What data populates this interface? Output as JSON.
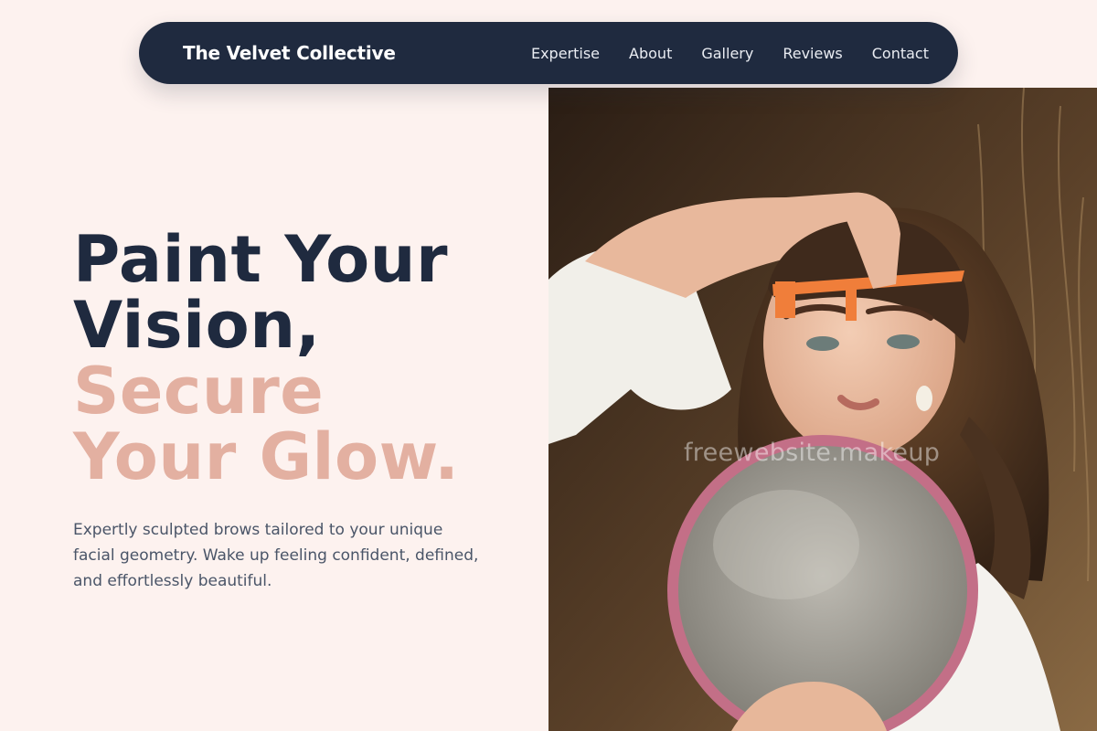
{
  "header": {
    "brand": "The Velvet Collective",
    "nav": [
      "Expertise",
      "About",
      "Gallery",
      "Reviews",
      "Contact"
    ]
  },
  "hero": {
    "headline_dark_1": "Paint Your",
    "headline_dark_2": "Vision,",
    "headline_accent_1": "Secure",
    "headline_accent_2": "Your Glow.",
    "subtext": "Expertly sculpted brows tailored to your unique facial geometry. Wake up feeling confident, defined, and effortlessly beautiful.",
    "image_alt": "Woman measuring her eyebrows with an orange caliper while holding a round mirror",
    "watermark": "freewebsite.makeup"
  },
  "colors": {
    "navy": "#1f2a3f",
    "blush_accent": "#e3b0a1",
    "background": "#fdf2ef",
    "body_text": "#4a5568"
  }
}
